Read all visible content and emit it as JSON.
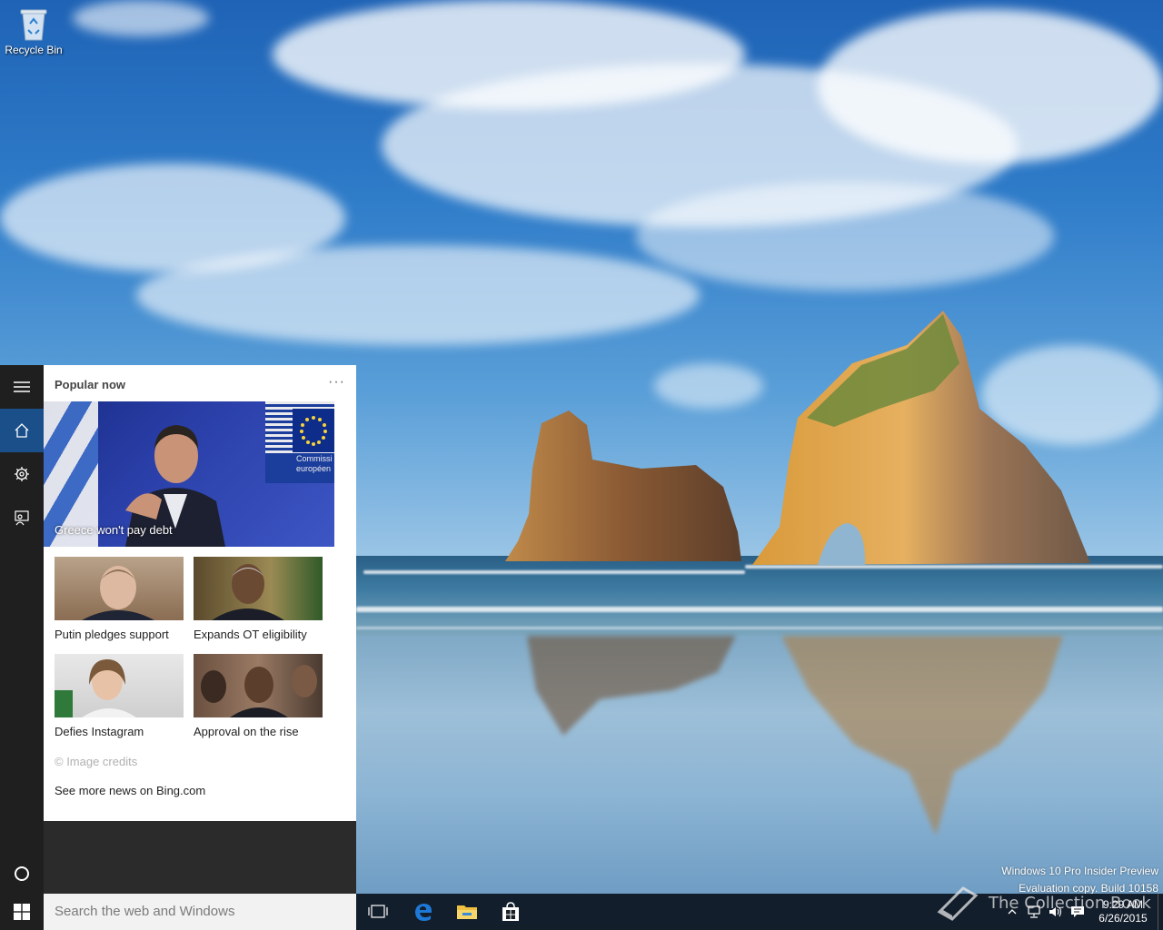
{
  "desktop": {
    "icons": [
      {
        "label": "Recycle Bin",
        "icon": "recycle-bin-icon"
      }
    ],
    "watermark": {
      "line1": "Windows 10 Pro Insider Preview",
      "line2": "Evaluation copy. Build 10158"
    },
    "brand_text": "The Collection Book"
  },
  "cortana": {
    "rail": {
      "menu_icon": "hamburger-menu-icon",
      "home_icon": "home-icon",
      "settings_icon": "gear-icon",
      "feedback_icon": "feedback-icon",
      "cortana_icon": "cortana-circle-icon"
    },
    "section_title": "Popular now",
    "more_label": "···",
    "hero": {
      "caption": "Greece won't pay debt",
      "sign_text": "Commissi européen"
    },
    "tiles": [
      {
        "label": "Putin pledges support"
      },
      {
        "label": "Expands OT eligibility"
      },
      {
        "label": "Defies Instagram"
      },
      {
        "label": "Approval on the rise"
      }
    ],
    "credits": "© Image credits",
    "bing_link": "See more news on Bing.com"
  },
  "taskbar": {
    "start_icon": "windows-logo-icon",
    "search_placeholder": "Search the web and Windows",
    "pinned": [
      {
        "icon": "task-view-icon"
      },
      {
        "icon": "edge-icon"
      },
      {
        "icon": "file-explorer-icon"
      },
      {
        "icon": "store-icon"
      }
    ],
    "tray": {
      "icons": [
        "chevron-up-icon",
        "network-icon",
        "volume-icon",
        "action-center-icon"
      ],
      "time": "9:29 AM",
      "date": "6/26/2015"
    }
  },
  "colors": {
    "accent": "#1a4f8a",
    "taskbar": "#10161e",
    "edge_blue": "#1e78d7",
    "explorer_yellow": "#f0c040"
  }
}
